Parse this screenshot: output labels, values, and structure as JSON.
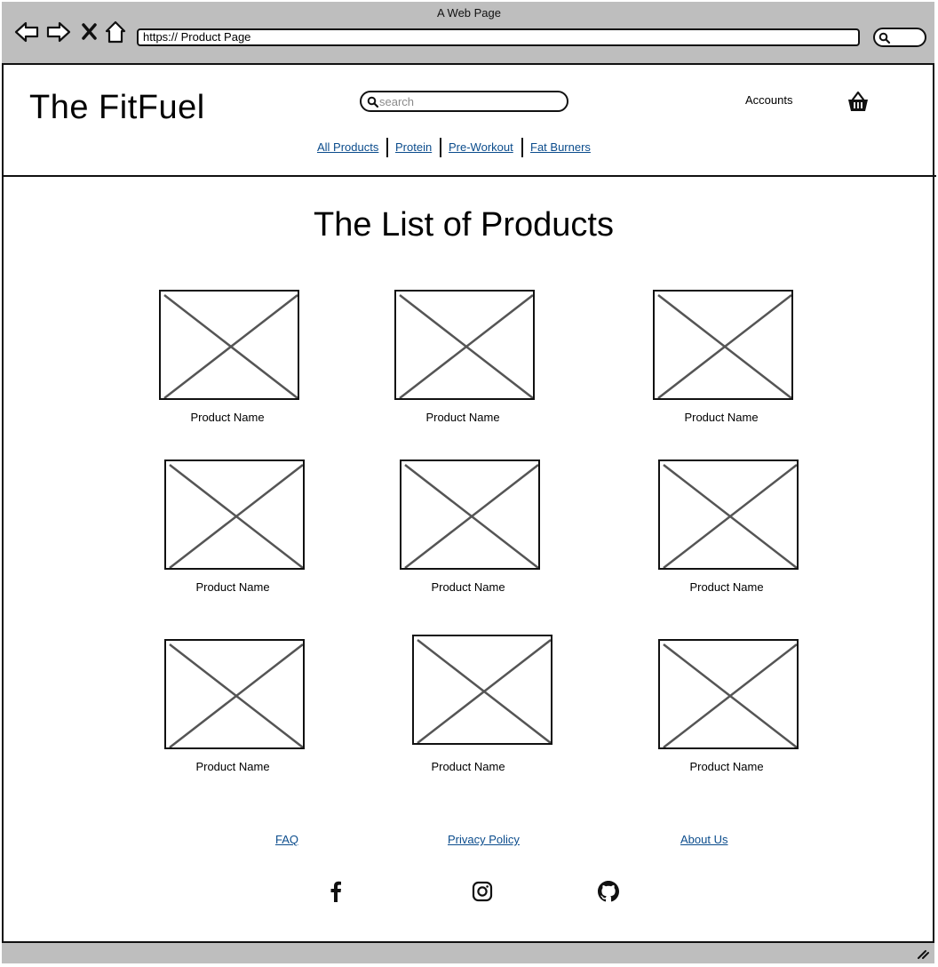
{
  "window": {
    "title": "A Web Page",
    "url": "https:// Product Page"
  },
  "header": {
    "brand": "The FitFuel",
    "search_placeholder": "search",
    "accounts": "Accounts",
    "categories": [
      "All Products",
      "Protein",
      "Pre-Workout",
      "Fat Burners"
    ]
  },
  "main": {
    "title": "The List of Products",
    "products": [
      "Product Name",
      "Product Name",
      "Product Name",
      "Product Name",
      "Product Name",
      "Product Name",
      "Product Name",
      "Product Name",
      "Product Name"
    ]
  },
  "footer": {
    "links": [
      "FAQ",
      "Privacy Policy",
      "About Us"
    ],
    "social": [
      "facebook-icon",
      "instagram-icon",
      "github-icon"
    ]
  },
  "colors": {
    "link": "#0b4c8c",
    "chrome": "#bebebe",
    "placeholder_stroke": "#555555"
  }
}
